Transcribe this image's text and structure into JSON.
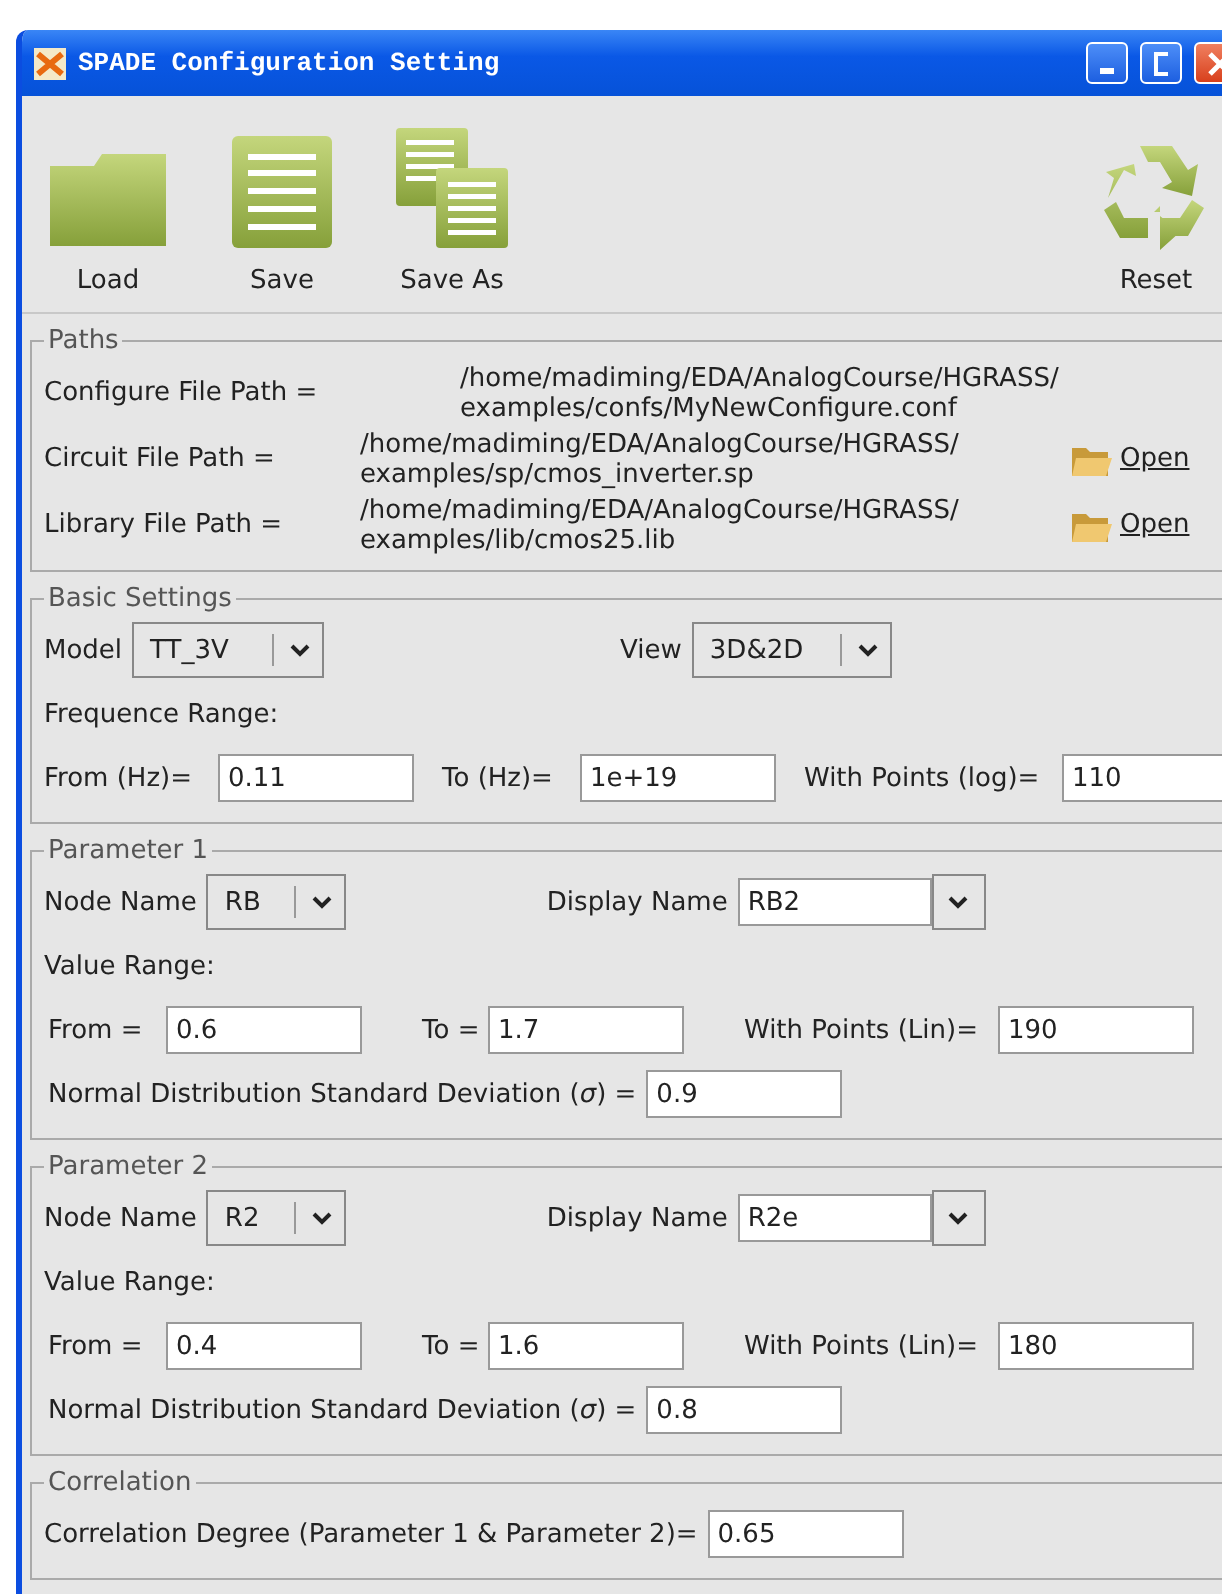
{
  "window": {
    "title": "SPADE Configuration Setting"
  },
  "toolbar": [
    {
      "label": "Load",
      "kind": "folder"
    },
    {
      "label": "Save",
      "kind": "page"
    },
    {
      "label": "Save As",
      "kind": "pages"
    },
    {
      "label": "Reset",
      "kind": "recycle"
    }
  ],
  "paths": {
    "title": "Paths",
    "rows": [
      {
        "label": "Configure File Path =",
        "value_lines": [
          "/home/madiming/EDA/AnalogCourse/HGRASS/",
          "examples/confs/MyNewConfigure.conf"
        ]
      },
      {
        "label": "Circuit File Path =",
        "value_lines": [
          "/home/madiming/EDA/AnalogCourse/HGRASS/",
          "examples/sp/cmos_inverter.sp"
        ],
        "action": "Open"
      },
      {
        "label": "Library File Path =",
        "value_lines": [
          "/home/madiming/EDA/AnalogCourse/HGRASS/",
          "examples/lib/cmos25.lib"
        ],
        "action": "Open"
      }
    ]
  },
  "basic_settings": {
    "title": "Basic Settings",
    "model": {
      "label": "Model",
      "value": "TT_3V"
    },
    "view": {
      "label": "View",
      "value": "3D&2D"
    },
    "range_label": "Frequence Range:",
    "fields": [
      {
        "label": "From (Hz)=",
        "value": "0.11"
      },
      {
        "label": "To (Hz)=",
        "value": "1e+19"
      },
      {
        "label": "With Points (log)=",
        "value": "110"
      }
    ]
  },
  "parameters": [
    {
      "title": "Parameter 1",
      "node_name": {
        "label": "Node Name",
        "value": "RB"
      },
      "display_name": {
        "label": "Display Name",
        "value": "RB2"
      },
      "range_label": "Value Range:",
      "fields": [
        {
          "label": "From  =",
          "value": "0.6"
        },
        {
          "label": "To =",
          "value": "1.7"
        },
        {
          "label": "With Points (Lin)=",
          "value": "190"
        }
      ],
      "deviation": {
        "label": "Normal Distribution Standard Deviation (*σ*) =",
        "value": "0.9"
      }
    },
    {
      "title": "Parameter 2",
      "node_name": {
        "label": "Node Name",
        "value": "R2"
      },
      "display_name": {
        "label": "Display Name",
        "value": "R2e"
      },
      "range_label": "Value Range:",
      "fields": [
        {
          "label": "From  =",
          "value": "0.4"
        },
        {
          "label": "To =",
          "value": "1.6"
        },
        {
          "label": "With Points (Lin)=",
          "value": "180"
        }
      ],
      "deviation": {
        "label": "Normal Distribution Standard Deviation (*σ*) =",
        "value": "0.8"
      }
    }
  ],
  "correlation": {
    "title": "Correlation",
    "label": "Correlation Degree (Parameter 1 & Parameter 2)=",
    "value": "0.65"
  }
}
